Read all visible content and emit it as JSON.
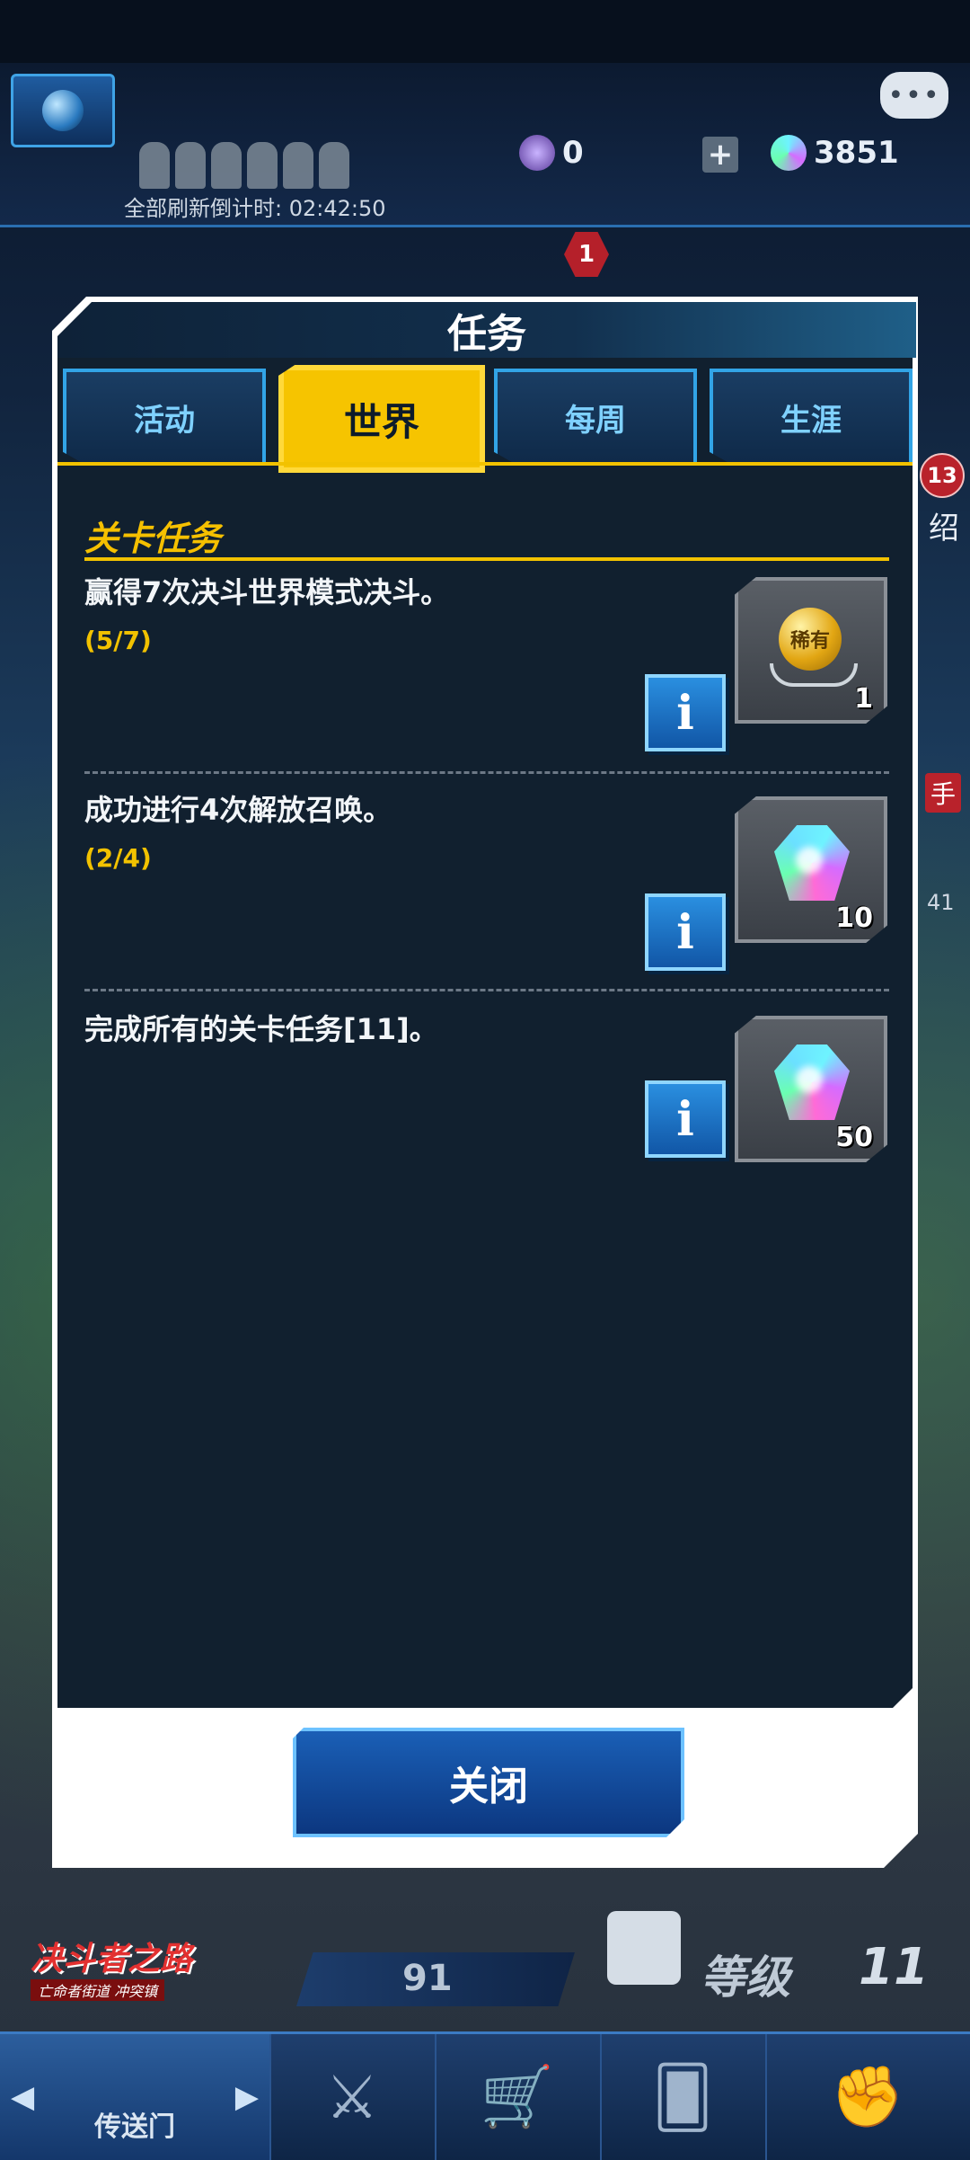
{
  "header": {
    "refresh_countdown": "全部刷新倒计时: 02:42:50",
    "currency_a": "0",
    "currency_b": "3851",
    "notification_badge": "1",
    "chat_dots": "•••"
  },
  "side": {
    "badge": "13",
    "text": "绍",
    "hand_text": "手",
    "number": "41"
  },
  "dialog": {
    "title": "任务",
    "tabs": [
      {
        "label": "活动",
        "active": false
      },
      {
        "label": "世界",
        "active": true
      },
      {
        "label": "每周",
        "active": false
      },
      {
        "label": "生涯",
        "active": false
      }
    ],
    "section_title": "关卡任务",
    "missions": [
      {
        "title": "赢得7次决斗世界模式决斗。",
        "progress": "(5/7)",
        "reward": "medal",
        "reward_label": "稀有",
        "quantity": "1"
      },
      {
        "title": "成功进行4次解放召唤。",
        "progress": "(2/4)",
        "reward": "gem",
        "quantity": "10"
      },
      {
        "title": "完成所有的关卡任务[11]。",
        "progress": "",
        "reward": "gem",
        "quantity": "50"
      }
    ],
    "info_symbol": "i",
    "close_label": "关闭"
  },
  "bottom": {
    "road_title": "决斗者之路",
    "road_subtitle": "亡命者街道 冲突镇",
    "stamina": "91",
    "level_label": "等级",
    "level_value": "11",
    "nav": {
      "portal_label": "传送门",
      "left_arrow": "◀",
      "right_arrow": "▶",
      "duel_icon": "⚔",
      "shop_icon": "🛒",
      "deck_icon": "🂠",
      "guild_icon": "✊"
    }
  },
  "colors": {
    "accent_gold": "#f2c200",
    "tab_blue": "#32a4e6",
    "panel": "#11202f"
  }
}
